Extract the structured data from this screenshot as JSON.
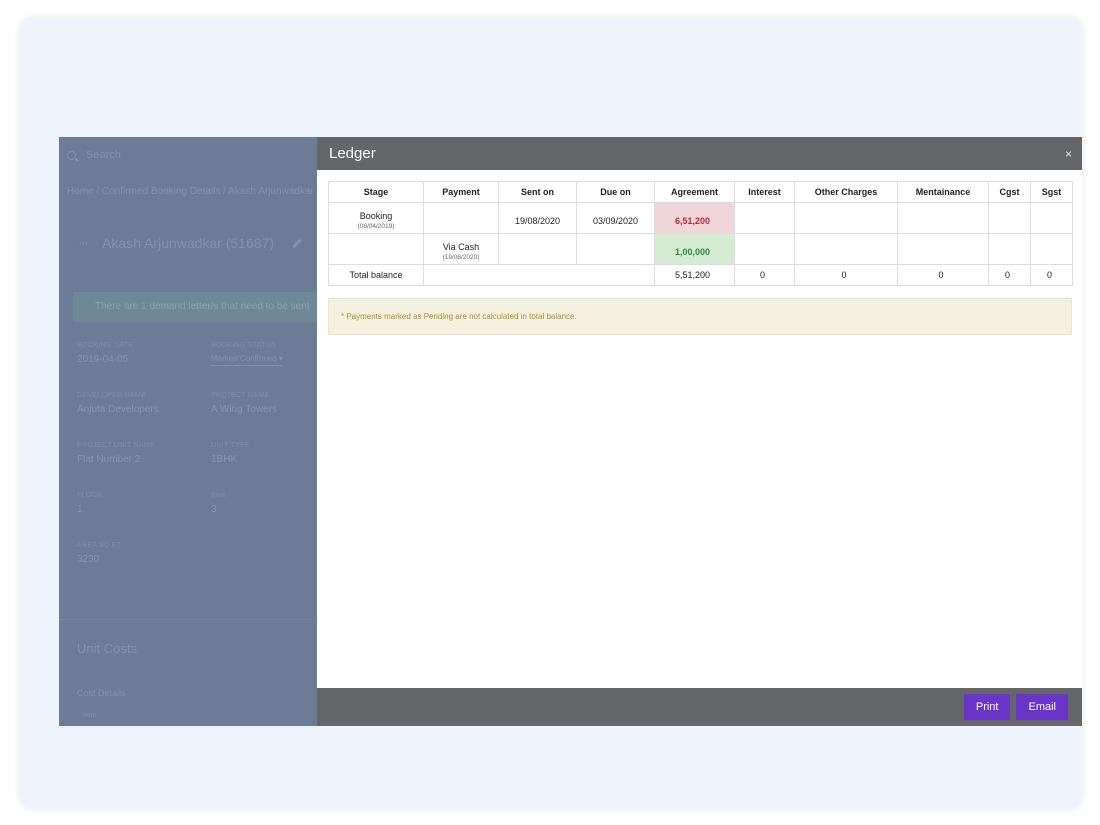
{
  "background_app": {
    "search_placeholder": "Search",
    "breadcrumb": "Home  /  Confirmed Booking Details  /  Akash Arjunwadkar",
    "customer_name": "Akash Arjunwadkar (51687)",
    "alert_text": "There are 1 demand letter/s that need to be sent",
    "fields": [
      {
        "label": "Booking Date",
        "value": "2019-04-05"
      },
      {
        "label": "Booking Status",
        "value": "Marked Confirmed"
      },
      {
        "label": "Developer Name",
        "value": "Anjuta Developers"
      },
      {
        "label": "Project Name",
        "value": "A Wing Towers"
      },
      {
        "label": "Project Unit Name",
        "value": "Flat Number 2"
      },
      {
        "label": "Unit Type",
        "value": "1BHK"
      },
      {
        "label": "Floor",
        "value": "1"
      },
      {
        "label": "BHK",
        "value": "3"
      },
      {
        "label": "Area Sq ft",
        "value": "3230"
      }
    ],
    "section_title": "Unit Costs",
    "sub_title": "Cost Details",
    "sub_item": "Item"
  },
  "modal": {
    "title": "Ledger",
    "close_glyph": "×",
    "table": {
      "headers": [
        "Stage",
        "Payment",
        "Sent on",
        "Due on",
        "Agreement",
        "Interest",
        "Other Charges",
        "Mentainance",
        "Cgst",
        "Sgst"
      ],
      "rows": [
        {
          "stage": "Booking",
          "stage_date": "(08/04/2019)",
          "payment": "",
          "payment_date": "",
          "sent_on": "19/08/2020",
          "due_on": "03/09/2020",
          "agreement": "6,51,200"
        },
        {
          "stage": "",
          "stage_date": "",
          "payment": "Via Cash",
          "payment_date": "(19/08/2020)",
          "sent_on": "",
          "due_on": "",
          "agreement": "1,00,000"
        }
      ],
      "total": {
        "label": "Total balance",
        "agreement": "5,51,200",
        "interest": "0",
        "other_charges": "0",
        "mentainance": "0",
        "cgst": "0",
        "sgst": "0"
      }
    },
    "note": "* Payments marked as Pending are not calculated in total balance.",
    "buttons": {
      "print": "Print",
      "email": "Email"
    }
  },
  "colors": {
    "header_bg": "#656669",
    "button_bg": "#6a35c8",
    "agreement_red_bg": "#f0d6d9",
    "agreement_green_bg": "#d5ecd3",
    "note_bg": "#f4f1e1"
  }
}
